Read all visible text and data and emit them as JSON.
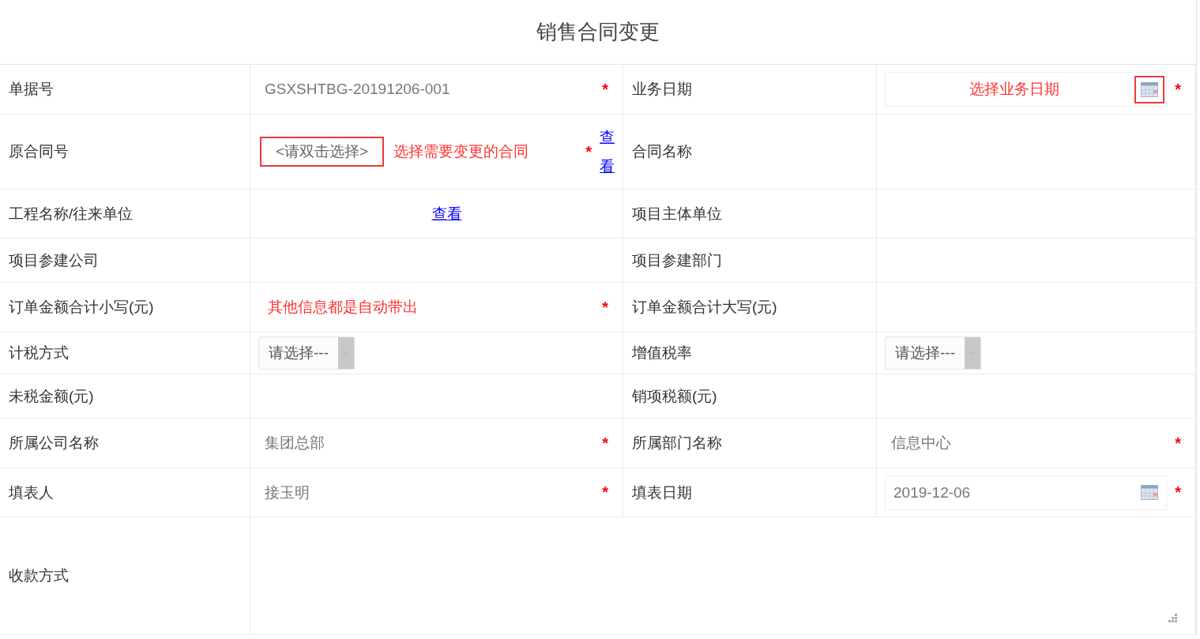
{
  "title": "销售合同变更",
  "rows": [
    {
      "cells": [
        {
          "label": "单据号",
          "field": {
            "kind": "text",
            "value": "GSXSHTBG-20191206-001"
          },
          "required_mark": "*"
        },
        {
          "label": "业务日期",
          "field": {
            "kind": "date",
            "placeholder": "选择业务日期",
            "icon_highlighted": true
          },
          "required_mark": "*"
        }
      ]
    },
    {
      "cells": [
        {
          "label": "原合同号",
          "field": {
            "kind": "picker",
            "placeholder": "<请双击选择>",
            "highlighted": true
          },
          "note": "选择需要变更的合同",
          "required_mark": "*",
          "link": "查看"
        },
        {
          "label": "合同名称"
        }
      ]
    },
    {
      "cells": [
        {
          "label": "工程名称/往来单位",
          "link": "查看"
        },
        {
          "label": "项目主体单位"
        }
      ]
    },
    {
      "cells": [
        {
          "label": "项目参建公司"
        },
        {
          "label": "项目参建部门"
        }
      ]
    },
    {
      "cells": [
        {
          "label": "订单金额合计小写(元)",
          "note": "其他信息都是自动带出",
          "required_mark": "*"
        },
        {
          "label": "订单金额合计大写(元)"
        }
      ]
    },
    {
      "cells": [
        {
          "label": "计税方式",
          "field": {
            "kind": "select",
            "placeholder": "请选择---"
          }
        },
        {
          "label": "增值税率",
          "field": {
            "kind": "select",
            "placeholder": "请选择---"
          }
        }
      ]
    },
    {
      "cells": [
        {
          "label": "未税金额(元)"
        },
        {
          "label": "销项税额(元)"
        }
      ]
    },
    {
      "cells": [
        {
          "label": "所属公司名称",
          "field": {
            "kind": "text",
            "value": "集团总部"
          },
          "required_mark": "*"
        },
        {
          "label": "所属部门名称",
          "field": {
            "kind": "text",
            "value": "信息中心"
          },
          "required_mark": "*"
        }
      ]
    },
    {
      "cells": [
        {
          "label": "填表人",
          "field": {
            "kind": "text",
            "value": "接玉明"
          },
          "required_mark": "*"
        },
        {
          "label": "填表日期",
          "field": {
            "kind": "date",
            "value": "2019-12-06",
            "icon_highlighted": false
          },
          "required_mark": "*"
        }
      ]
    },
    {
      "cells": [
        {
          "label": "收款方式",
          "field": {
            "kind": "textarea"
          }
        }
      ]
    }
  ]
}
